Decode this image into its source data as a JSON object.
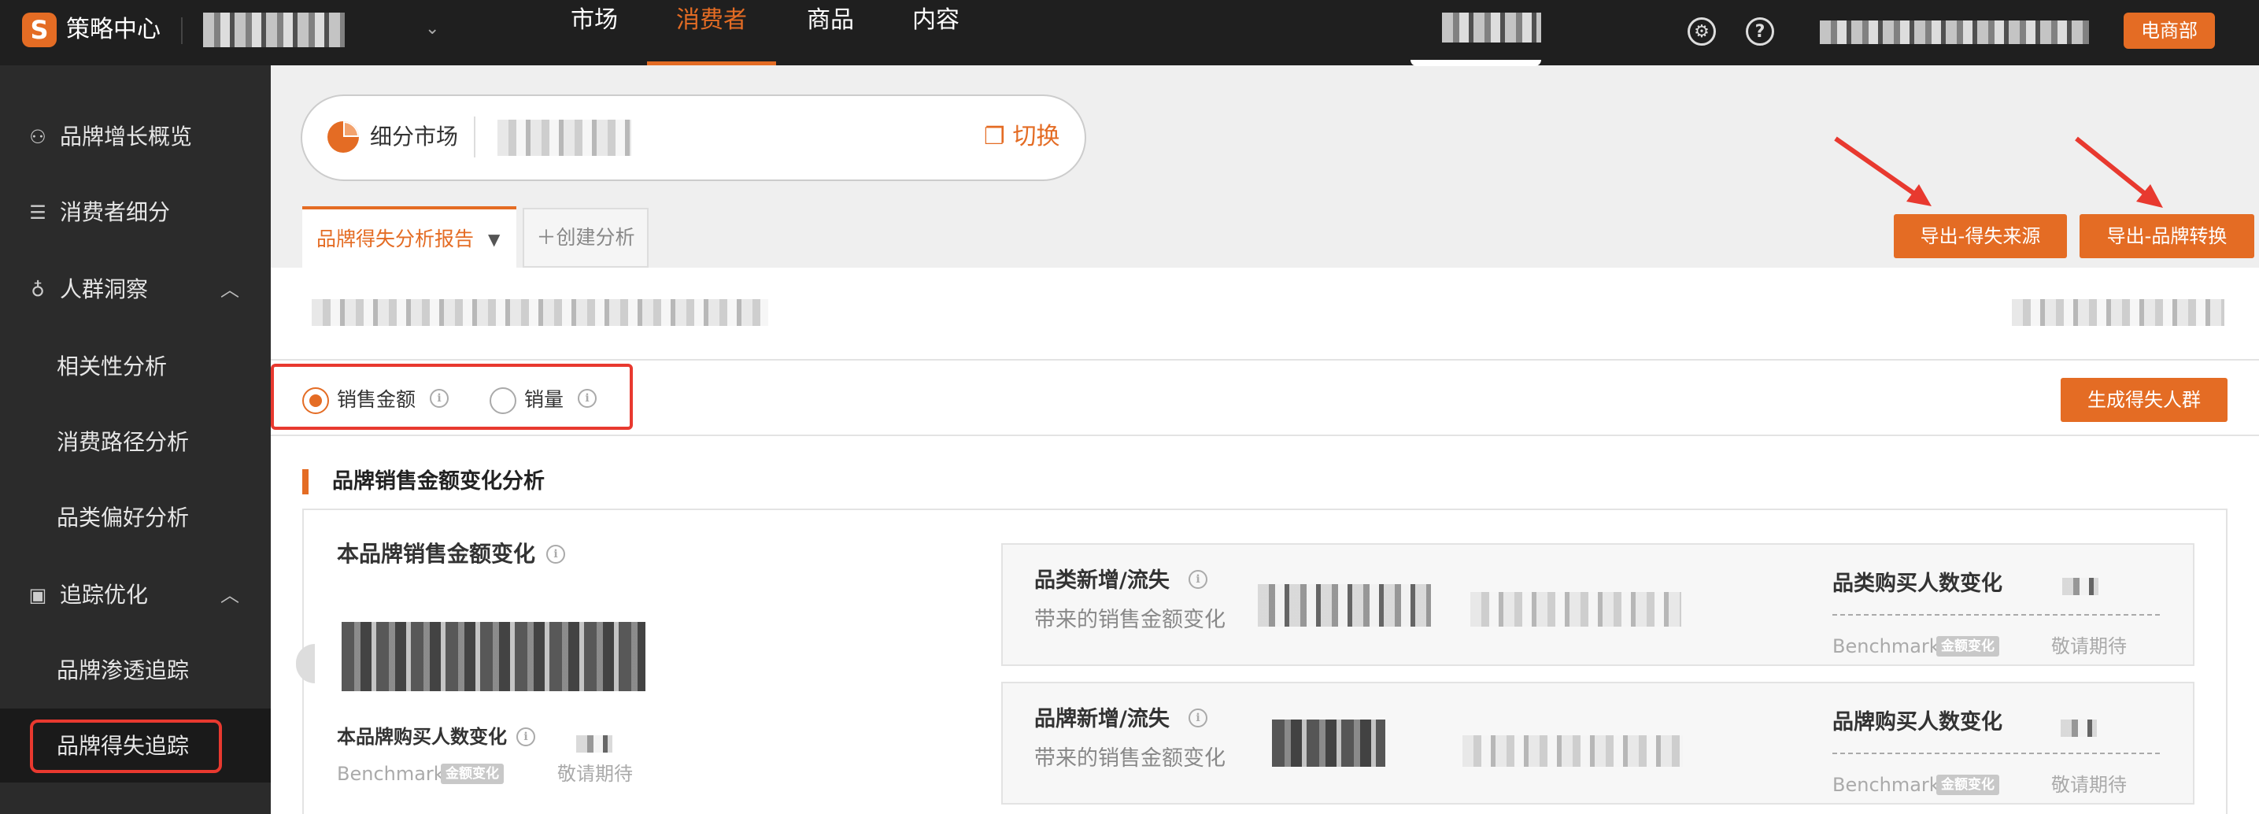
{
  "header": {
    "logo_glyph": "S",
    "app_title": "策略中心",
    "nav_tabs": [
      {
        "label": "市场"
      },
      {
        "label": "消费者"
      },
      {
        "label": "商品"
      },
      {
        "label": "内容"
      }
    ],
    "active_tab": "消费者",
    "department_button": "电商部",
    "icons": [
      "settings-icon",
      "help-icon"
    ]
  },
  "sidebar": {
    "items": [
      {
        "label": "品牌增长概览",
        "icon": "person-growth-icon"
      },
      {
        "label": "消费者细分",
        "icon": "segment-icon"
      },
      {
        "label": "人群洞察",
        "icon": "bulb-icon"
      },
      {
        "label": "相关性分析"
      },
      {
        "label": "消费路径分析"
      },
      {
        "label": "品类偏好分析"
      },
      {
        "label": "追踪优化",
        "icon": "clipboard-icon"
      },
      {
        "label": "品牌渗透追踪"
      },
      {
        "label": "品牌得失追踪"
      }
    ],
    "active_item": "品牌得失追踪"
  },
  "segment": {
    "label": "细分市场",
    "switch_label": "切换"
  },
  "tabs": {
    "report_label": "品牌得失分析报告",
    "create_label": "创建分析"
  },
  "toolbar": {
    "export_source_label": "导出-得失来源",
    "export_switch_label": "导出-品牌转换",
    "generate_label": "生成得失人群"
  },
  "metrics": {
    "options": [
      {
        "label": "销售金额",
        "checked": true
      },
      {
        "label": "销量",
        "checked": false
      }
    ]
  },
  "section": {
    "title": "品牌销售金额变化分析",
    "brand_change_title": "本品牌销售金额变化",
    "buyers_change_label": "本品牌购买人数变化",
    "benchmark_label": "Benchmark",
    "benchmark_tag": "金额变化",
    "pending_label": "敬请期待"
  },
  "panels": [
    {
      "title": "品类新增/流失",
      "subtitle": "带来的销售金额变化",
      "right_title": "品类购买人数变化",
      "benchmark_label": "Benchmark",
      "benchmark_tag": "金额变化",
      "pending_label": "敬请期待"
    },
    {
      "title": "品牌新增/流失",
      "subtitle": "带来的销售金额变化",
      "right_title": "品牌购买人数变化",
      "benchmark_label": "Benchmark",
      "benchmark_tag": "金额变化",
      "pending_label": "敬请期待"
    }
  ],
  "colors": {
    "accent": "#e46c24",
    "annotation_red": "#e8392f",
    "topbar": "#1f1f1f",
    "sidebar": "#2b2b2b"
  }
}
